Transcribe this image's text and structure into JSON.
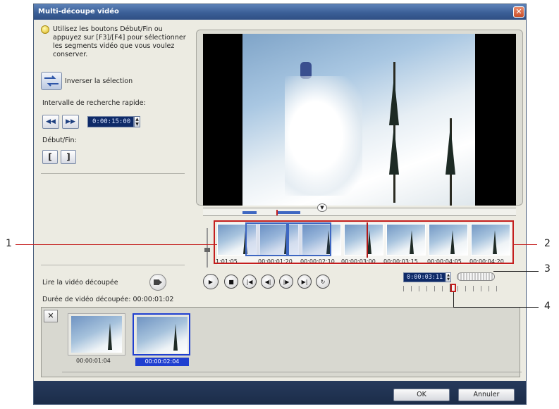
{
  "window": {
    "title": "Multi-découpe vidéo",
    "close_label": "✕"
  },
  "left_panel": {
    "hint_lines": [
      "Utilisez les boutons Début/Fin ou",
      "appuyez sur [F3]/[F4] pour sélectionner",
      "les segments vidéo que vous voulez",
      "conserver."
    ],
    "invert_label": "Inverser la sélection",
    "quick_search_label": "Intervalle de recherche rapide:",
    "quick_search_value": "0:00:15:00",
    "start_end_label": "Début/Fin:",
    "start_bracket": "[",
    "end_bracket": "]",
    "play_trimmed_label": "Lire la vidéo découpée",
    "duration_label": "Durée de vidéo découpée: 00:00:01:02"
  },
  "filmstrip": {
    "timecodes": [
      "1:01:05",
      "00:00:01:20",
      "00:00:02:10",
      "00:00:03:00",
      "00:00:03:15",
      "00:00:04:05",
      "00:00:04:20"
    ]
  },
  "controls": {
    "timecode": "0:00:03:11"
  },
  "clips": {
    "items": [
      {
        "time": "00:00:01:04",
        "selected": false
      },
      {
        "time": "00:00:02:04",
        "selected": true
      }
    ]
  },
  "callouts": {
    "one": "1",
    "two": "2",
    "three": "3",
    "four": "4"
  },
  "buttons": {
    "ok": "OK",
    "cancel": "Annuler"
  },
  "colors": {
    "title_bar": "#3b5f97",
    "selection": "#3e67c2",
    "callout_red": "#c41e1e",
    "bottom_bar": "#1b2c48"
  }
}
